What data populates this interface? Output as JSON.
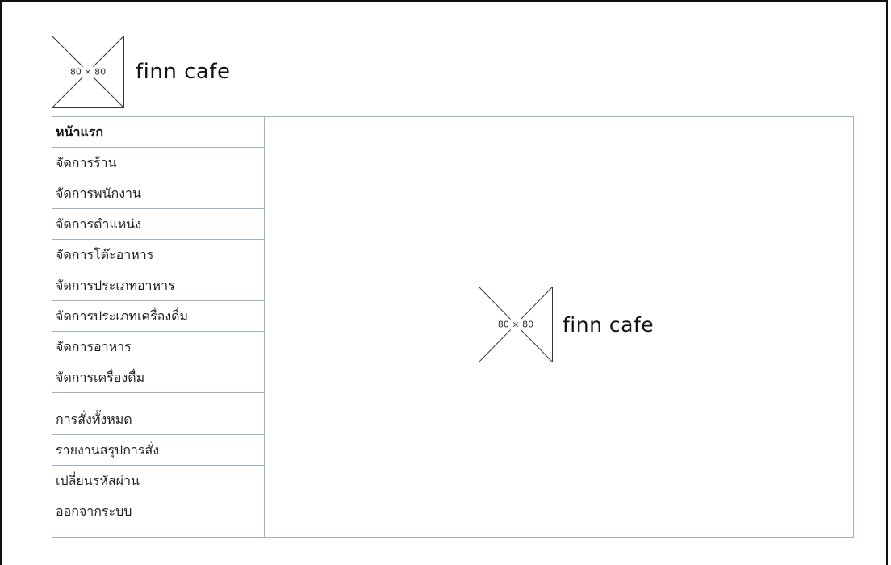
{
  "header": {
    "logo_placeholder": "80 × 80",
    "title": "finn cafe"
  },
  "sidebar": {
    "items": [
      {
        "label": "หน้าแรก",
        "active": true
      },
      {
        "label": "จัดการร้าน"
      },
      {
        "label": "จัดการพนักงาน"
      },
      {
        "label": "จัดการตำแหน่ง"
      },
      {
        "label": "จัดการโต๊ะอาหาร"
      },
      {
        "label": "จัดการประเภทอาหาร"
      },
      {
        "label": "จัดการประเภทเครื่องดื่ม"
      },
      {
        "label": "จัดการอาหาร"
      },
      {
        "label": "จัดการเครื่องดื่ม"
      }
    ],
    "secondary_items": [
      {
        "label": "การสั่งทั้งหมด"
      },
      {
        "label": "รายงานสรุปการสั่ง"
      },
      {
        "label": "เปลี่ยนรหัสผ่าน"
      },
      {
        "label": "ออกจากระบบ"
      }
    ]
  },
  "main": {
    "logo_placeholder": "80 × 80",
    "title": "finn cafe"
  },
  "colors": {
    "border": "#9db2cc",
    "frame": "#111111"
  }
}
